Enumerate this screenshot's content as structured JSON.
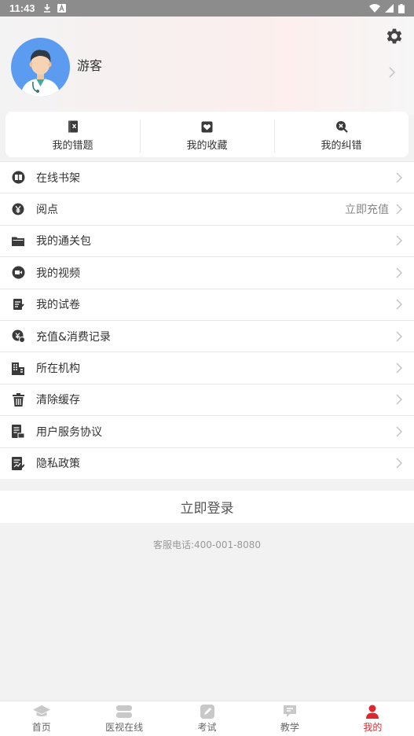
{
  "status_bar": {
    "time": "11:43"
  },
  "profile": {
    "name": "游客"
  },
  "quick_actions": [
    {
      "label": "我的错题",
      "icon": "notebook-x-icon"
    },
    {
      "label": "我的收藏",
      "icon": "heart-icon"
    },
    {
      "label": "我的纠错",
      "icon": "search-x-icon"
    }
  ],
  "menu": [
    {
      "label": "在线书架",
      "icon": "book-icon"
    },
    {
      "label": "阅点",
      "icon": "yen-coin-icon",
      "extra": "立即充值"
    },
    {
      "label": "我的通关包",
      "icon": "folder-icon"
    },
    {
      "label": "我的视频",
      "icon": "video-icon"
    },
    {
      "label": "我的试卷",
      "icon": "exam-paper-icon"
    },
    {
      "label": "充值&消费记录",
      "icon": "recharge-icon"
    },
    {
      "label": "所在机构",
      "icon": "building-icon"
    },
    {
      "label": "清除缓存",
      "icon": "trash-icon"
    },
    {
      "label": "用户服务协议",
      "icon": "agreement-icon"
    },
    {
      "label": "隐私政策",
      "icon": "policy-icon"
    }
  ],
  "login_label": "立即登录",
  "service_phone": "客服电话:400-001-8080",
  "tabs": [
    {
      "label": "首页",
      "icon": "graduation-cap-icon",
      "active": false
    },
    {
      "label": "医视在线",
      "icon": "layers-icon",
      "active": false
    },
    {
      "label": "考试",
      "icon": "pen-icon",
      "active": false
    },
    {
      "label": "教学",
      "icon": "board-icon",
      "active": false
    },
    {
      "label": "我的",
      "icon": "user-icon",
      "active": true
    }
  ],
  "colors": {
    "accent": "#e0262d",
    "avatar_bg": "#5b9bf0",
    "icon_gray": "#444444"
  }
}
